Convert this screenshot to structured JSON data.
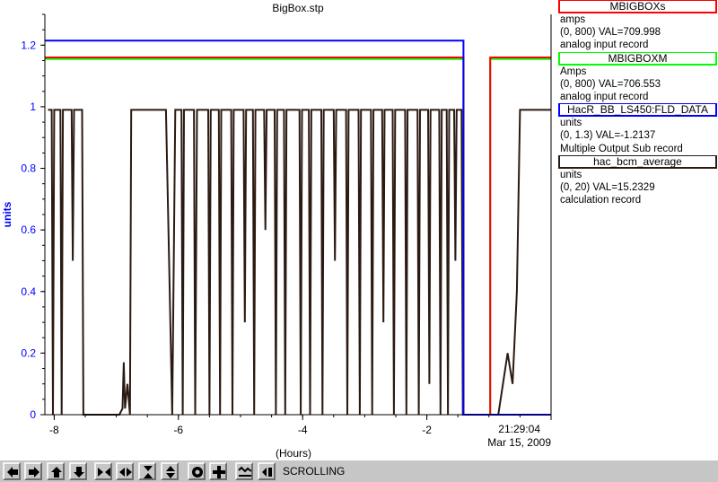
{
  "chart_data": {
    "type": "line",
    "title": "BigBox.stp",
    "xlabel": "(Hours)",
    "ylabel": "units",
    "x_range": [
      -8.15,
      0
    ],
    "y_range": [
      0,
      1.3
    ],
    "x_ticks": [
      {
        "value": -8,
        "label": "-8"
      },
      {
        "value": -6,
        "label": "-6"
      },
      {
        "value": -4,
        "label": "-4"
      },
      {
        "value": -2,
        "label": "-2"
      }
    ],
    "y_ticks": [
      {
        "value": 0,
        "label": "0"
      },
      {
        "value": 0.2,
        "label": "0.2"
      },
      {
        "value": 0.4,
        "label": "0.4"
      },
      {
        "value": 0.6,
        "label": "0.6"
      },
      {
        "value": 0.8,
        "label": "0.8"
      },
      {
        "value": 1.0,
        "label": "1"
      },
      {
        "value": 1.2,
        "label": "1.2"
      }
    ],
    "end_time": {
      "time": "21:29:04",
      "date": "Mar 15, 2009"
    },
    "series": [
      {
        "name": "MBIGBOXs",
        "color": "#ff0000",
        "points": [
          [
            -8.15,
            1.16
          ],
          [
            -1.41,
            1.16
          ],
          [
            -1.41,
            0
          ],
          [
            -0.98,
            0
          ],
          [
            -0.98,
            1.16
          ],
          [
            0,
            1.16
          ]
        ]
      },
      {
        "name": "MBIGBOXM",
        "color": "#00ff00",
        "points": [
          [
            -8.15,
            1.155
          ],
          [
            -1.41,
            1.155
          ],
          [
            -1.41,
            0
          ],
          [
            -0.98,
            0
          ],
          [
            -0.98,
            1.155
          ],
          [
            0,
            1.155
          ]
        ]
      },
      {
        "name": "HacR_BB_LS450:FLD_DATA",
        "color": "#0000ff",
        "points": [
          [
            -8.15,
            1.215
          ],
          [
            -1.41,
            1.215
          ],
          [
            -1.41,
            0
          ],
          [
            0,
            0
          ]
        ]
      },
      {
        "name": "hac_bcm_average",
        "color": "#2b1a12",
        "points": [
          [
            -8.1,
            0.99
          ],
          [
            -8.04,
            0.99
          ],
          [
            -8.02,
            0
          ],
          [
            -8.0,
            0.99
          ],
          [
            -7.9,
            0.99
          ],
          [
            -7.88,
            0
          ],
          [
            -7.86,
            0.99
          ],
          [
            -7.72,
            0.99
          ],
          [
            -7.7,
            0.5
          ],
          [
            -7.68,
            0.99
          ],
          [
            -7.55,
            0.99
          ],
          [
            -7.53,
            0
          ],
          [
            -7.1,
            0
          ],
          [
            -6.95,
            0
          ],
          [
            -6.9,
            0.02
          ],
          [
            -6.88,
            0.17
          ],
          [
            -6.86,
            0.02
          ],
          [
            -6.82,
            0.1
          ],
          [
            -6.78,
            0
          ],
          [
            -6.76,
            0.99
          ],
          [
            -6.2,
            0.99
          ],
          [
            -6.15,
            0.5
          ],
          [
            -6.1,
            0
          ],
          [
            -6.05,
            0.99
          ],
          [
            -5.95,
            0.99
          ],
          [
            -5.93,
            0
          ],
          [
            -5.91,
            0.99
          ],
          [
            -5.75,
            0.99
          ],
          [
            -5.73,
            0
          ],
          [
            -5.7,
            0.99
          ],
          [
            -5.52,
            0.99
          ],
          [
            -5.5,
            0
          ],
          [
            -5.48,
            0.99
          ],
          [
            -5.35,
            0.99
          ],
          [
            -5.33,
            0
          ],
          [
            -5.31,
            0.99
          ],
          [
            -5.15,
            0.99
          ],
          [
            -5.13,
            0
          ],
          [
            -5.11,
            0.99
          ],
          [
            -4.95,
            0.99
          ],
          [
            -4.93,
            0.3
          ],
          [
            -4.91,
            0.99
          ],
          [
            -4.8,
            0.99
          ],
          [
            -4.78,
            0
          ],
          [
            -4.76,
            0.99
          ],
          [
            -4.62,
            0.99
          ],
          [
            -4.6,
            0.6
          ],
          [
            -4.58,
            0.99
          ],
          [
            -4.45,
            0.99
          ],
          [
            -4.43,
            0
          ],
          [
            -4.41,
            0.99
          ],
          [
            -4.3,
            0.99
          ],
          [
            -4.28,
            0
          ],
          [
            -4.26,
            0.99
          ],
          [
            -4.05,
            0.99
          ],
          [
            -4.03,
            0
          ],
          [
            -4.01,
            0.99
          ],
          [
            -3.9,
            0.99
          ],
          [
            -3.88,
            0
          ],
          [
            -3.86,
            0.99
          ],
          [
            -3.7,
            0.99
          ],
          [
            -3.68,
            0
          ],
          [
            -3.66,
            0.99
          ],
          [
            -3.5,
            0.99
          ],
          [
            -3.48,
            0.5
          ],
          [
            -3.46,
            0.99
          ],
          [
            -3.3,
            0.99
          ],
          [
            -3.28,
            0
          ],
          [
            -3.26,
            0.99
          ],
          [
            -3.1,
            0.99
          ],
          [
            -3.08,
            0
          ],
          [
            -3.06,
            0.99
          ],
          [
            -2.9,
            0.99
          ],
          [
            -2.88,
            0
          ],
          [
            -2.86,
            0.99
          ],
          [
            -2.72,
            0.99
          ],
          [
            -2.7,
            0.3
          ],
          [
            -2.68,
            0.99
          ],
          [
            -2.55,
            0.99
          ],
          [
            -2.53,
            0
          ],
          [
            -2.51,
            0.99
          ],
          [
            -2.35,
            0.99
          ],
          [
            -2.33,
            0
          ],
          [
            -2.31,
            0.99
          ],
          [
            -2.15,
            0.99
          ],
          [
            -2.13,
            0
          ],
          [
            -2.11,
            0.99
          ],
          [
            -1.98,
            0.99
          ],
          [
            -1.96,
            0.1
          ],
          [
            -1.94,
            0.99
          ],
          [
            -1.8,
            0.99
          ],
          [
            -1.78,
            0
          ],
          [
            -1.76,
            0.99
          ],
          [
            -1.68,
            0.99
          ],
          [
            -1.66,
            0
          ],
          [
            -1.64,
            0.99
          ],
          [
            -1.56,
            0.99
          ],
          [
            -1.54,
            0.5
          ],
          [
            -1.52,
            0.99
          ],
          [
            -1.44,
            0.99
          ],
          [
            -1.42,
            0
          ],
          [
            -0.95,
            0
          ],
          [
            -0.85,
            0
          ],
          [
            -0.7,
            0.2
          ],
          [
            -0.62,
            0.1
          ],
          [
            -0.55,
            0.4
          ],
          [
            -0.5,
            0.99
          ],
          [
            0,
            0.99
          ]
        ]
      }
    ]
  },
  "legend": [
    {
      "title": "MBIGBOXs",
      "color": "#ff0000",
      "units": "amps",
      "range_val": "(0, 800) VAL=709.998",
      "record": "analog input record"
    },
    {
      "title": "MBIGBOXM",
      "color": "#00ff00",
      "units": "Amps",
      "range_val": "(0, 800) VAL=706.553",
      "record": "analog input record"
    },
    {
      "title": "HacR_BB_LS450:FLD_DATA",
      "color": "#0000ff",
      "units": "units",
      "range_val": "(0, 1.3) VAL=-1.2137",
      "record": "Multiple Output Sub record"
    },
    {
      "title": "hac_bcm_average",
      "color": "#2b1a12",
      "units": "units",
      "range_val": "(0, 20) VAL=15.2329",
      "record": "calculation record"
    }
  ],
  "toolbar": {
    "buttons": [
      {
        "icon": "arrow-left-icon",
        "name": "scroll-left-button"
      },
      {
        "icon": "arrow-right-icon",
        "name": "scroll-right-button"
      },
      {
        "icon": "arrow-up-icon",
        "name": "scroll-up-button"
      },
      {
        "icon": "arrow-down-icon",
        "name": "scroll-down-button"
      },
      {
        "icon": "expand-horizontal-icon",
        "name": "zoom-in-x-button"
      },
      {
        "icon": "compress-horizontal-icon",
        "name": "zoom-out-x-button"
      },
      {
        "icon": "expand-vertical-icon",
        "name": "zoom-in-y-button"
      },
      {
        "icon": "compress-vertical-icon",
        "name": "zoom-out-y-button"
      },
      {
        "icon": "target-icon",
        "name": "center-button"
      },
      {
        "icon": "crosshair-plus-icon",
        "name": "auto-scale-button"
      },
      {
        "icon": "graph-icon",
        "name": "graph-button"
      },
      {
        "icon": "scroll-mode-icon",
        "name": "scroll-mode-button"
      }
    ],
    "status": "SCROLLING"
  }
}
